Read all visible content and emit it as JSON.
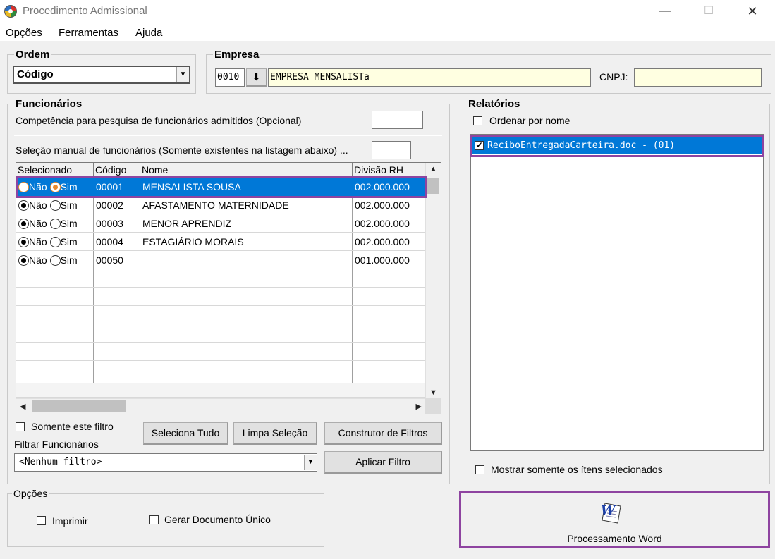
{
  "window": {
    "title": "Procedimento Admissional"
  },
  "menu": [
    "Opções",
    "Ferramentas",
    "Ajuda"
  ],
  "ordem": {
    "label": "Ordem",
    "selected": "Código"
  },
  "empresa": {
    "label": "Empresa",
    "code": "0010",
    "name": "EMPRESA MENSALISTa",
    "cnpj_label": "CNPJ:",
    "cnpj_value": ""
  },
  "funcionarios": {
    "label": "Funcionários",
    "competencia_label": "Competência para pesquisa de funcionários admitidos (Opcional)",
    "selecao_label": "Seleção manual de funcionários (Somente existentes na listagem abaixo) ...",
    "columns": [
      "Selecionado",
      "Código",
      "Nome",
      "Divisão RH"
    ],
    "radio_labels": {
      "nao": "Não",
      "sim": "Sim"
    },
    "rows": [
      {
        "selected": "Sim",
        "codigo": "00001",
        "nome": "MENSALISTA SOUSA",
        "divisao": "002.000.000"
      },
      {
        "selected": "Não",
        "codigo": "00002",
        "nome": "AFASTAMENTO MATERNIDADE",
        "divisao": "002.000.000"
      },
      {
        "selected": "Não",
        "codigo": "00003",
        "nome": "MENOR APRENDIZ",
        "divisao": "002.000.000"
      },
      {
        "selected": "Não",
        "codigo": "00004",
        "nome": "ESTAGIÁRIO MORAIS",
        "divisao": "002.000.000"
      },
      {
        "selected": "Não",
        "codigo": "00050",
        "nome": "",
        "divisao": "001.000.000"
      }
    ],
    "somente_filtro": "Somente este filtro",
    "seleciona_tudo": "Seleciona Tudo",
    "limpa_selecao": "Limpa Seleção",
    "construtor_filtros": "Construtor de Filtros",
    "filtrar_label": "Filtrar Funcionários",
    "filtro_value": "<Nenhum filtro>",
    "aplicar_filtro": "Aplicar Filtro"
  },
  "relatorios": {
    "label": "Relatórios",
    "ordenar_nome": "Ordenar por nome",
    "items": [
      {
        "label": "ReciboEntregadaCarteira.doc - (01)",
        "checked": true
      }
    ],
    "mostrar_selecionados": "Mostrar somente os ítens selecionados"
  },
  "opcoes": {
    "label": "Opções",
    "imprimir": "Imprimir",
    "gerar_unico": "Gerar Documento Único"
  },
  "processamento": {
    "label": "Processamento Word"
  },
  "colors": {
    "selection": "#0078d7",
    "highlight": "#8e44a0",
    "yellow_field": "#ffffe1"
  }
}
